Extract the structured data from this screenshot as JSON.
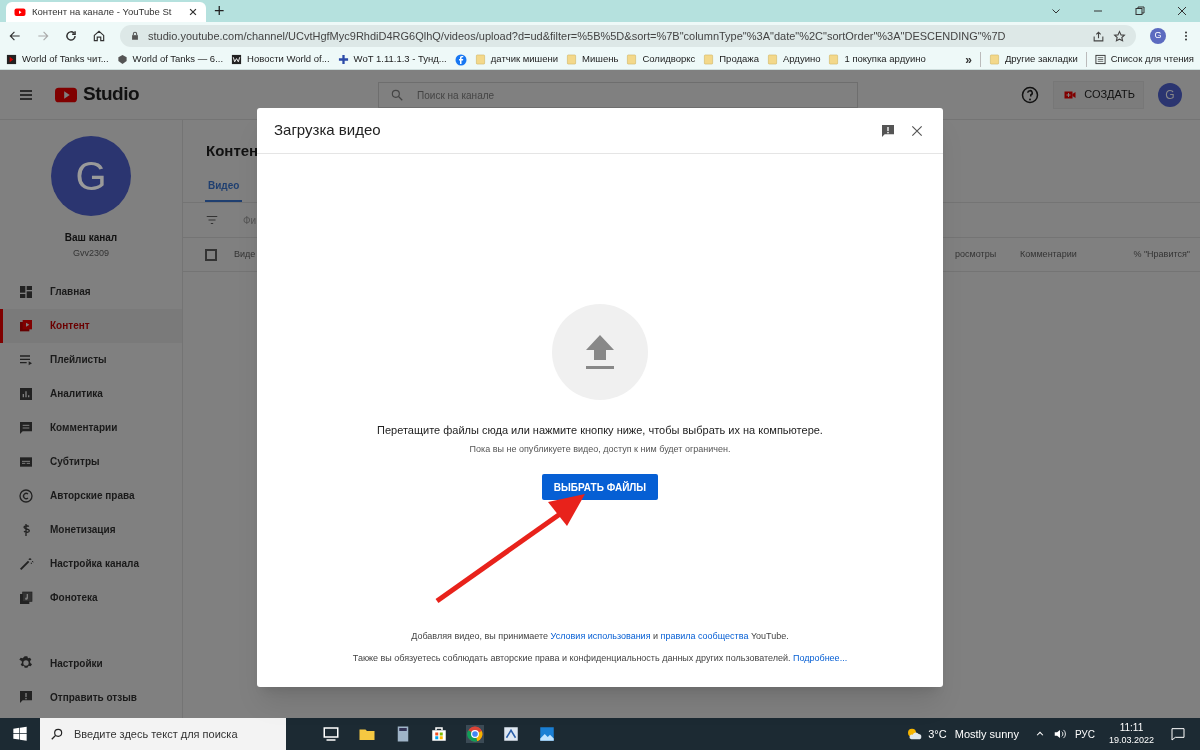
{
  "browser": {
    "tab_title": "Контент на канале - YouTube St",
    "new_tab": "+",
    "url": "studio.youtube.com/channel/UCvtHgfMyc9RhdiD4RG6QlhQ/videos/upload?d=ud&filter=%5B%5D&sort=%7B\"columnType\"%3A\"date\"%2C\"sortOrder\"%3A\"DESCENDING\"%7D",
    "profile": "G",
    "bookmarks": [
      {
        "label": "World of Tanks чит...",
        "kind": "site"
      },
      {
        "label": "World of Tanks — 6...",
        "kind": "site"
      },
      {
        "label": "Новости World of...",
        "kind": "site"
      },
      {
        "label": "WoT 1.11.1.3 - Тунд...",
        "kind": "site"
      },
      {
        "kind": "facebook"
      },
      {
        "label": "датчик мишени",
        "kind": "folder"
      },
      {
        "label": "Мишень",
        "kind": "folder"
      },
      {
        "label": "Солидворкс",
        "kind": "folder"
      },
      {
        "label": "Продажа",
        "kind": "folder"
      },
      {
        "label": "Ардуино",
        "kind": "folder"
      },
      {
        "label": "1 покупка  ардуино",
        "kind": "folder"
      }
    ],
    "more": "»",
    "other_bookmarks": "Другие закладки",
    "reading_list": "Список для чтения"
  },
  "studio": {
    "logo": "Studio",
    "search_placeholder": "Поиск на канале",
    "create": "СОЗДАТЬ",
    "avatar": "G",
    "channel": {
      "avatar": "G",
      "title": "Ваш канал",
      "handle": "Gvv2309"
    },
    "nav": [
      {
        "label": "Главная",
        "selected": false
      },
      {
        "label": "Контент",
        "selected": true
      },
      {
        "label": "Плейлисты",
        "selected": false
      },
      {
        "label": "Аналитика",
        "selected": false
      },
      {
        "label": "Комментарии",
        "selected": false
      },
      {
        "label": "Субтитры",
        "selected": false
      },
      {
        "label": "Авторские права",
        "selected": false
      },
      {
        "label": "Монетизация",
        "selected": false
      },
      {
        "label": "Настройка канала",
        "selected": false
      },
      {
        "label": "Фонотека",
        "selected": false
      }
    ],
    "nav_bottom": [
      {
        "label": "Настройки",
        "selected": false
      },
      {
        "label": "Отправить отзыв",
        "selected": false
      }
    ],
    "page_title": "Контен",
    "tabs": [
      {
        "label": "Видео",
        "selected": true
      }
    ],
    "filter_placeholder": "Фи",
    "select_all_checked": false,
    "columns": [
      "Виде",
      "росмотры",
      "Комментарии",
      "% \"Нравится\""
    ]
  },
  "dialog": {
    "title": "Загрузка видео",
    "main_text": "Перетащите файлы сюда или нажмите кнопку ниже, чтобы выбрать их на компьютере.",
    "sub_text": "Пока вы не опубликуете видео, доступ к ним будет ограничен.",
    "button": "ВЫБРАТЬ ФАЙЛЫ",
    "footer": [
      [
        {
          "kind": "text",
          "text": "Добавляя видео, вы принимаете "
        },
        {
          "kind": "link",
          "text": "Условия использования"
        },
        {
          "kind": "text",
          "text": " и "
        },
        {
          "kind": "link",
          "text": "правила сообщества"
        },
        {
          "kind": "text",
          "text": " YouTube."
        }
      ],
      [
        {
          "kind": "text",
          "text": "Также вы обязуетесь соблюдать авторские права и конфиденциальность данных других пользователей. "
        },
        {
          "kind": "link",
          "text": "Подробнее..."
        }
      ]
    ]
  },
  "taskbar": {
    "search_placeholder": "Введите здесь текст для поиска",
    "temperature": "3°C",
    "weather": "Mostly sunny",
    "language": "РУС",
    "time": "11:11",
    "date": "19.03.2022"
  }
}
